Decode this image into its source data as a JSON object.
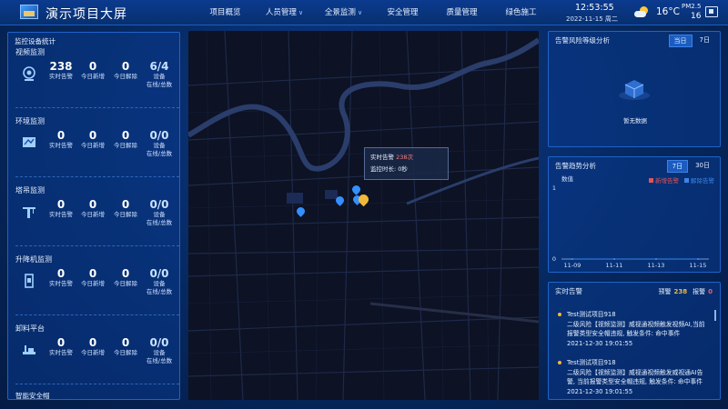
{
  "header": {
    "title": "演示项目大屏",
    "nav": [
      {
        "label": "项目概览",
        "chevron": false
      },
      {
        "label": "人员管理",
        "chevron": true
      },
      {
        "label": "全景监测",
        "chevron": true
      },
      {
        "label": "安全管理",
        "chevron": false
      },
      {
        "label": "质量管理",
        "chevron": false
      },
      {
        "label": "绿色施工",
        "chevron": false
      }
    ],
    "time": "12:53:55",
    "date": "2022-11-15 周二",
    "weather_icon": "partly-cloudy-icon",
    "temperature": "16°C",
    "pm_label": "PM2.5",
    "pm_value": "16",
    "fullscreen_icon": "screen-icon"
  },
  "left": {
    "title": "监控设备统计",
    "sections": [
      {
        "label": "视频监测",
        "icon": "camera-icon",
        "alarms": "238",
        "new": "0",
        "cleared": "0",
        "ratio": "6/4"
      },
      {
        "label": "环境监测",
        "icon": "environment-icon",
        "alarms": "0",
        "new": "0",
        "cleared": "0",
        "ratio": "0/0"
      },
      {
        "label": "塔吊监测",
        "icon": "tower-crane-icon",
        "alarms": "0",
        "new": "0",
        "cleared": "0",
        "ratio": "0/0"
      },
      {
        "label": "升降机监测",
        "icon": "elevator-icon",
        "alarms": "0",
        "new": "0",
        "cleared": "0",
        "ratio": "0/0"
      },
      {
        "label": "卸料平台",
        "icon": "platform-icon",
        "alarms": "0",
        "new": "0",
        "cleared": "0",
        "ratio": "0/0"
      }
    ],
    "stat_labels": {
      "alarms": "实时告警",
      "new": "今日新增",
      "cleared": "今日解除",
      "ratio1": "设备",
      "ratio2": "在线/总数"
    },
    "next_section": "智能安全帽"
  },
  "map": {
    "tooltip_label": "实时告警",
    "tooltip_value": "238次",
    "tooltip_row2": "监控时长: 0秒"
  },
  "risk": {
    "title": "告警风险等级分析",
    "tab_day": "当日",
    "tab_week": "7日",
    "empty": "暂无数据"
  },
  "trend": {
    "title": "告警趋势分析",
    "tab_week": "7日",
    "tab_month": "30日",
    "legend_new": "新增告警",
    "legend_cleared": "解除告警",
    "new_color": "#e0555b",
    "cleared_color": "#3a86e8"
  },
  "chart_data": {
    "type": "line",
    "title": "",
    "ylabel": "数值",
    "x": [
      "11-09",
      "11-11",
      "11-13",
      "11-15"
    ],
    "series": [
      {
        "name": "新增告警",
        "values": [
          0,
          0,
          0,
          0
        ]
      },
      {
        "name": "解除告警",
        "values": [
          0,
          0,
          0,
          0
        ]
      }
    ],
    "yticks": [
      "1",
      "0"
    ],
    "ylim": [
      0,
      1
    ],
    "grid": false,
    "legend_position": "top-right"
  },
  "alarms": {
    "title": "实时告警",
    "warn_label": "预警",
    "warn_value": "238",
    "alarm_label": "报警",
    "alarm_value": "0",
    "items": [
      {
        "line1": "Test测试项目918",
        "line2": "二级风险【视频监测】威视通视频触发视频AI,当前",
        "line3": "报警类型安全帽违规, 触发条件: 命中事件",
        "line4": "2021-12-30 19:01:55"
      },
      {
        "line1": "Test测试项目918",
        "line2": "二级风险【视频监测】威视通视频触发威视通AI告",
        "line3": "警, 当前报警类型安全帽违规, 触发条件: 命中事件",
        "line4": "2021-12-30 19:01:55"
      }
    ]
  }
}
